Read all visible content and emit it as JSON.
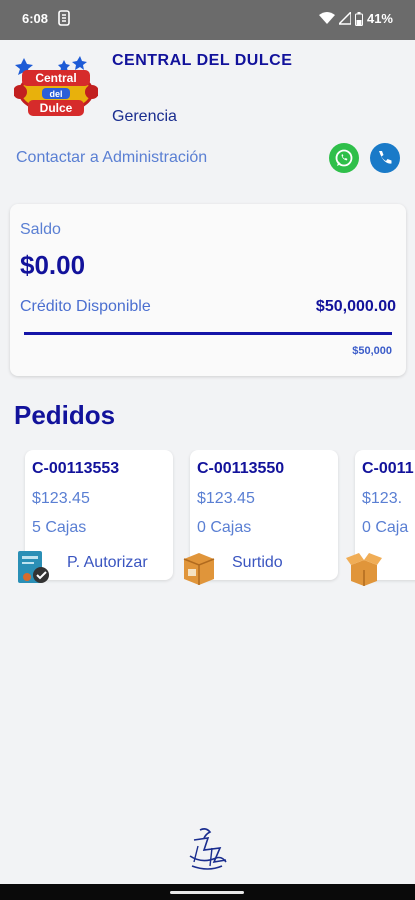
{
  "status_bar": {
    "time": "6:08",
    "battery": "41%"
  },
  "header": {
    "company": "CENTRAL DEL DULCE",
    "role": "Gerencia",
    "contact_label": "Contactar a Administración",
    "logo_text": [
      "Central",
      "del",
      "Dulce"
    ]
  },
  "balance": {
    "saldo_label": "Saldo",
    "saldo_value": "$0.00",
    "credit_label": "Crédito Disponible",
    "credit_value": "$50,000.00",
    "credit_limit": "$50,000",
    "credit_fraction": 1.0
  },
  "pedidos_title": "Pedidos",
  "orders": [
    {
      "id": "C-00113553",
      "amount": "$123.45",
      "boxes": "5 Cajas",
      "status": "P. Autorizar",
      "icon": "authorize-icon"
    },
    {
      "id": "C-00113550",
      "amount": "$123.45",
      "boxes": "0 Cajas",
      "status": "Surtido",
      "icon": "box-closed-icon"
    },
    {
      "id": "C-0011",
      "amount": "$123.",
      "boxes": "0 Caja",
      "status": "",
      "icon": "box-open-icon"
    }
  ],
  "colors": {
    "primary": "#12129b",
    "accent": "#5a7fd3",
    "whatsapp": "#2fbf4a",
    "phone": "#1a7ac8"
  }
}
